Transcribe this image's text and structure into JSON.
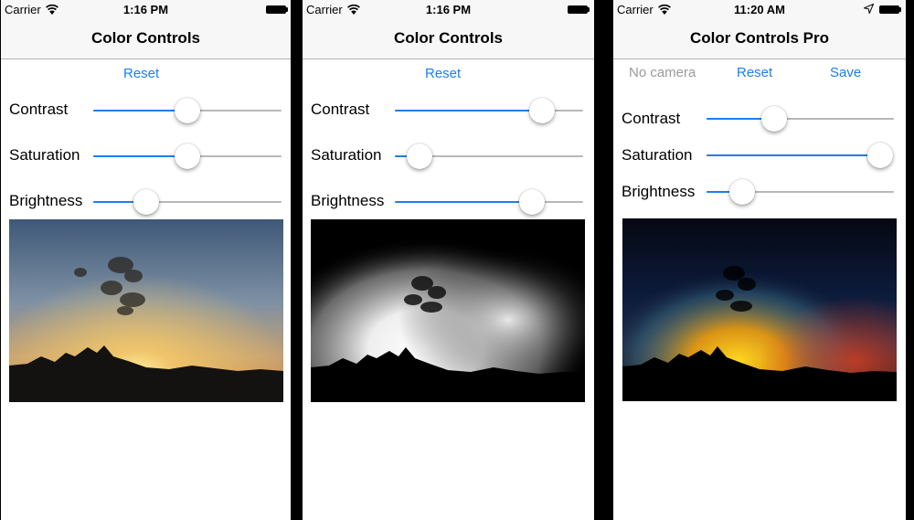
{
  "phones": [
    {
      "status": {
        "carrier": "Carrier",
        "time": "1:16 PM"
      },
      "nav": {
        "title": "Color Controls"
      },
      "toolbar": {
        "reset_label": "Reset"
      },
      "sliders": [
        {
          "label": "Contrast",
          "value": 0.5
        },
        {
          "label": "Saturation",
          "value": 0.5
        },
        {
          "label": "Brightness",
          "value": 0.28
        }
      ],
      "photo": {
        "style": "normal"
      }
    },
    {
      "status": {
        "carrier": "Carrier",
        "time": "1:16 PM"
      },
      "nav": {
        "title": "Color Controls"
      },
      "toolbar": {
        "reset_label": "Reset"
      },
      "sliders": [
        {
          "label": "Contrast",
          "value": 0.78
        },
        {
          "label": "Saturation",
          "value": 0.13
        },
        {
          "label": "Brightness",
          "value": 0.73
        }
      ],
      "photo": {
        "style": "bright-desaturated"
      }
    },
    {
      "status": {
        "carrier": "Carrier",
        "time": "11:20 AM"
      },
      "nav": {
        "title": "Color Controls Pro"
      },
      "toolbar": {
        "camera_label": "No camera",
        "reset_label": "Reset",
        "save_label": "Save"
      },
      "sliders": [
        {
          "label": "Contrast",
          "value": 0.36
        },
        {
          "label": "Saturation",
          "value": 1.0
        },
        {
          "label": "Brightness",
          "value": 0.19
        }
      ],
      "photo": {
        "style": "saturated-dark"
      }
    }
  ],
  "colors": {
    "tint": "#1a7ff0",
    "disabled": "#9b9b9b",
    "track": "#b8b8b8"
  }
}
